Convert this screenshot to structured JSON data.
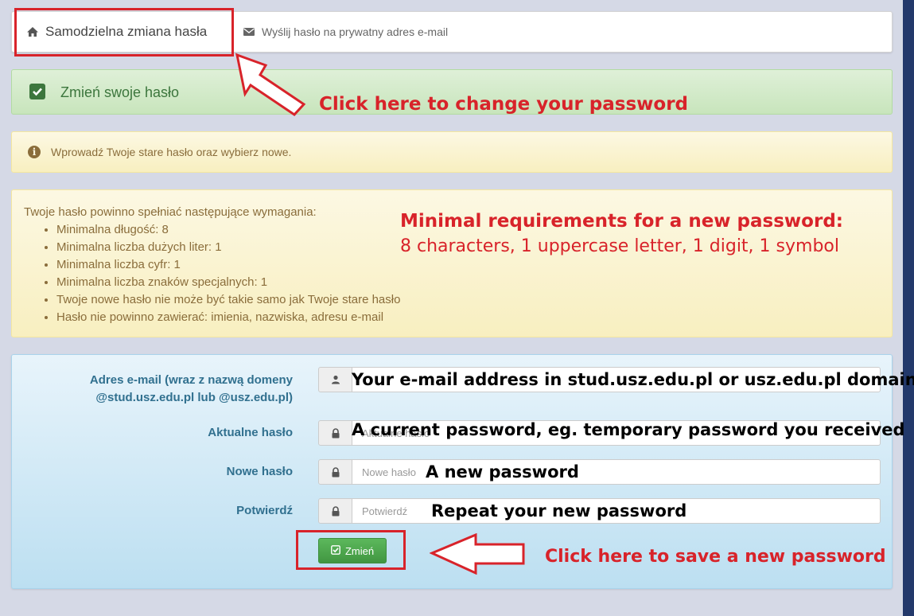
{
  "tabs": [
    {
      "label": "Samodzielna zmiana hasła",
      "icon": "home-icon",
      "active": true
    },
    {
      "label": "Wyślij hasło na prywatny adres e-mail",
      "icon": "envelope-icon",
      "active": false
    }
  ],
  "success": {
    "text": "Zmień swoje hasło",
    "icon": "checkbox-icon"
  },
  "info": {
    "text": "Wprowadź Twoje stare hasło oraz wybierz nowe.",
    "icon": "info-icon"
  },
  "requirements": {
    "title": "Twoje hasło powinno spełniać następujące wymagania:",
    "items": [
      "Minimalna długość: 8",
      "Minimalna liczba dużych liter: 1",
      "Minimalna liczba cyfr: 1",
      "Minimalna liczba znaków specjalnych: 1",
      "Twoje nowe hasło nie może być takie samo jak Twoje stare hasło",
      "Hasło nie powinno zawierać: imienia, nazwiska, adresu e-mail"
    ],
    "note_title": "Minimal requirements for a new password:",
    "note_sub": "8 characters, 1 uppercase letter, 1 digit, 1 symbol"
  },
  "form": {
    "email_label_line1": "Adres e-mail (wraz z nazwą domeny",
    "email_label_line2": "@stud.usz.edu.pl lub @usz.edu.pl)",
    "email_overlay": "Your e-mail address in stud.usz.edu.pl or usz.edu.pl domain",
    "current_label": "Aktualne hasło",
    "current_placeholder": "Aktualne hasło",
    "current_overlay": "A current password, eg. temporary password you received",
    "new_label": "Nowe hasło",
    "new_placeholder": "Nowe hasło",
    "new_overlay": "A new password",
    "confirm_label": "Potwierdź",
    "confirm_placeholder": "Potwierdź",
    "confirm_overlay": "Repeat your new password",
    "save_label": "Zmień"
  },
  "annotations": {
    "change_password": "Click here to change your password",
    "save_password": "Click here to save a new password"
  },
  "colors": {
    "annotation_red": "#d8232a",
    "success_green": "#3c763d",
    "warning_text": "#8a6d3b",
    "label_blue": "#31708f",
    "button_green": "#5cb85c"
  }
}
